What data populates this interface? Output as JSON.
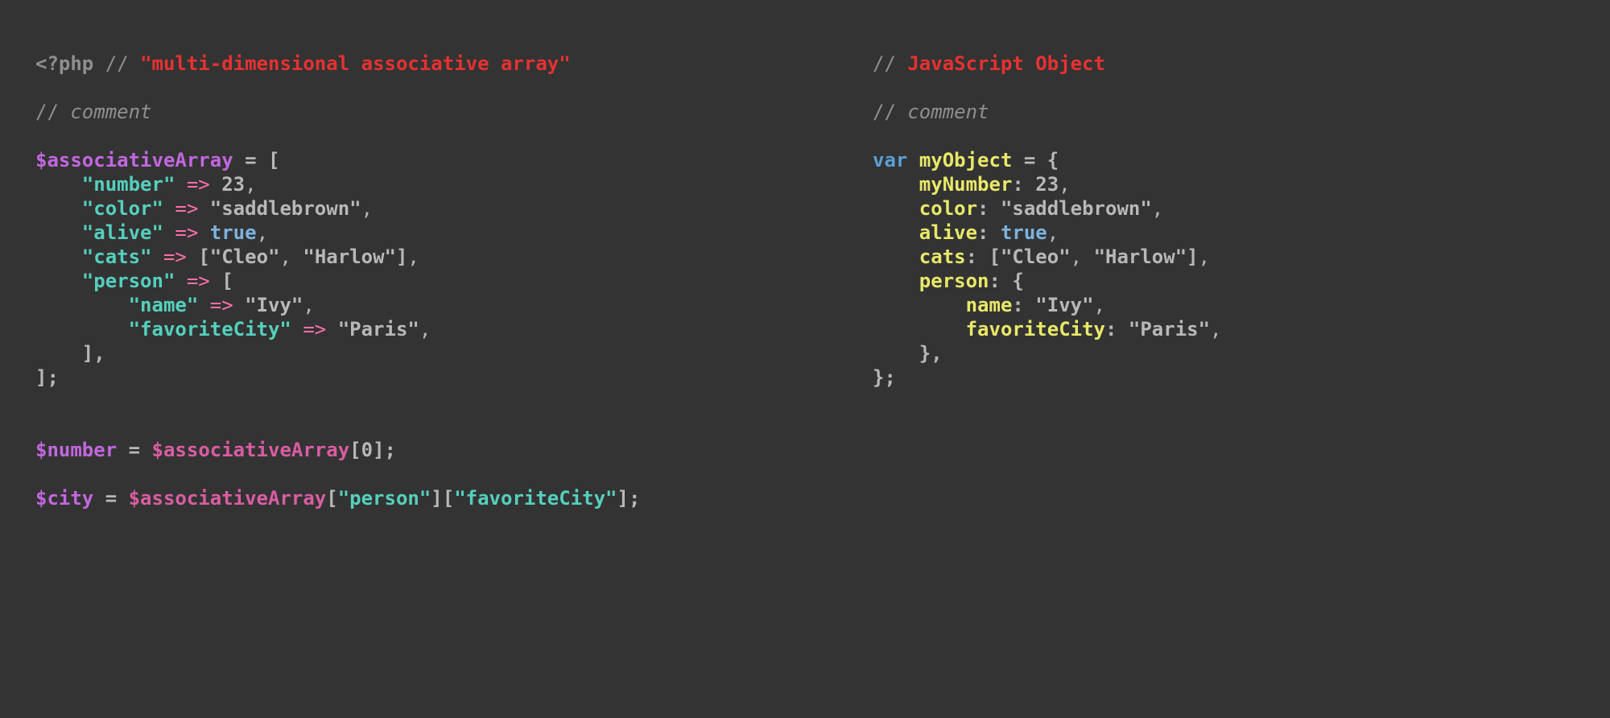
{
  "left": {
    "opentag": "<?php",
    "slashes": "//",
    "title": "\"multi-dimensional associative array\"",
    "comment_line": "comment",
    "var_assoc": "$associativeArray",
    "var_number": "$number",
    "var_city": "$city",
    "eq_open": " = [",
    "k_number": "\"number\"",
    "k_color": "\"color\"",
    "k_alive": "\"alive\"",
    "k_cats": "\"cats\"",
    "k_person": "\"person\"",
    "k_name": "\"name\"",
    "k_favcity": "\"favoriteCity\"",
    "arrow": "=>",
    "v_23": "23",
    "v_saddle": "\"saddlebrown\"",
    "v_true": "true",
    "v_cat1": "\"Cleo\"",
    "v_cat2": "\"Harlow\"",
    "v_ivy": "\"Ivy\"",
    "v_paris": "\"Paris\"",
    "cats_open": "[",
    "cats_close": "]",
    "open_nested": "[",
    "close_nested": "],",
    "close_outer": "];",
    "idx0": "0",
    "k_person_access": "\"person\"",
    "k_favcity_access": "\"favoriteCity\"",
    "equals": " = ",
    "comma": ",",
    "comma_sp": ", ",
    "lbracket": "[",
    "rbracket": "]",
    "semicolon": ";"
  },
  "right": {
    "slashes": "//",
    "title": "JavaScript Object",
    "comment_line": "comment",
    "kw_var": "var",
    "ident_myObject": "myObject",
    "eq_open": " = {",
    "k_myNumber": "myNumber",
    "k_color": "color",
    "k_alive": "alive",
    "k_cats": "cats",
    "k_person": "person",
    "k_name": "name",
    "k_favcity": "favoriteCity",
    "v_23": "23",
    "v_saddle": "\"saddlebrown\"",
    "v_true": "true",
    "v_cat1": "\"Cleo\"",
    "v_cat2": "\"Harlow\"",
    "v_ivy": "\"Ivy\"",
    "v_paris": "\"Paris\"",
    "cats_open": "[",
    "cats_close": "]",
    "open_brace": "{",
    "close_brace_comma": "},",
    "close_outer": "};",
    "colon": ":",
    "comma": ",",
    "comma_sp": ", "
  },
  "colors": {
    "bg": "#333333",
    "default": "#b8b8b8",
    "dim": "#8f8f8f",
    "red": "#e73131",
    "purple": "#c267e0",
    "magenta": "#d95da3",
    "teal": "#55d0bd",
    "pink": "#ff6fa8",
    "blue": "#5b9fd4",
    "lblue": "#7db2dd",
    "yellow": "#e8e86a"
  }
}
